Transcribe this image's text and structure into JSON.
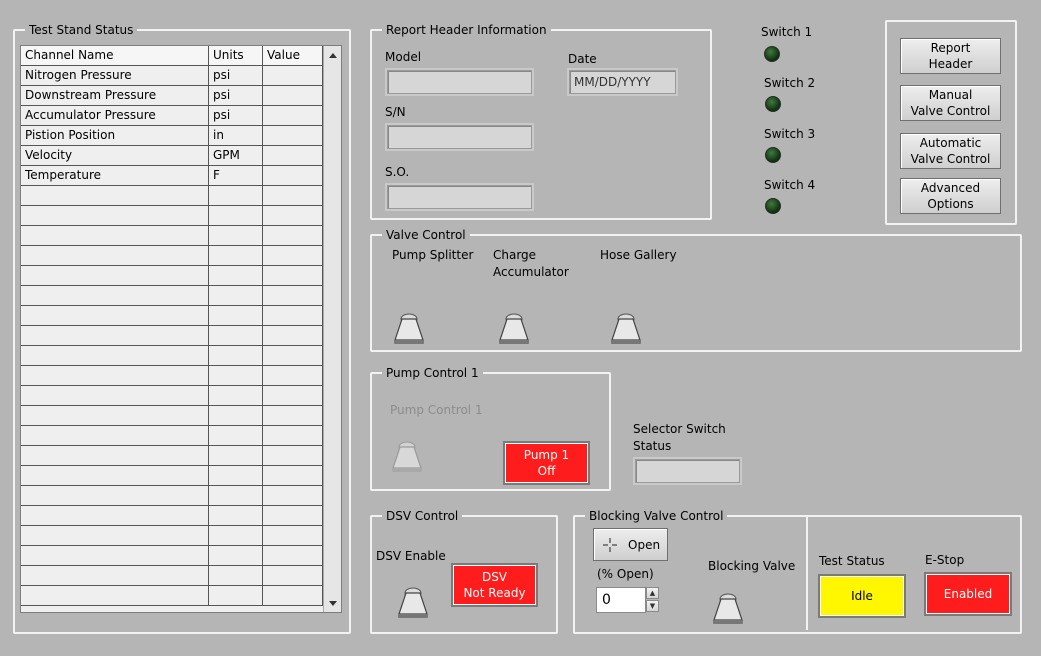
{
  "test_stand": {
    "title": "Test Stand Status",
    "columns": [
      "Channel Name",
      "Units",
      "Value"
    ],
    "rows": [
      {
        "name": "Nitrogen Pressure",
        "units": "psi",
        "value": ""
      },
      {
        "name": "Downstream Pressure",
        "units": "psi",
        "value": ""
      },
      {
        "name": "Accumulator Pressure",
        "units": "psi",
        "value": ""
      },
      {
        "name": "Pistion Position",
        "units": "in",
        "value": ""
      },
      {
        "name": "Velocity",
        "units": "GPM",
        "value": ""
      },
      {
        "name": "Temperature",
        "units": "F",
        "value": ""
      }
    ]
  },
  "report_header": {
    "title": "Report Header Information",
    "model_label": "Model",
    "model_value": "",
    "sn_label": "S/N",
    "sn_value": "",
    "so_label": "S.O.",
    "so_value": "",
    "date_label": "Date",
    "date_value": "MM/DD/YYYY"
  },
  "switches": [
    "Switch 1",
    "Switch 2",
    "Switch 3",
    "Switch 4"
  ],
  "nav_buttons": {
    "report_header": "Report\nHeader",
    "manual_valve": "Manual\nValve Control",
    "automatic_valve": "Automatic\nValve Control",
    "advanced": "Advanced\nOptions"
  },
  "valve_control": {
    "title": "Valve Control",
    "pump_splitter": "Pump Splitter",
    "charge_accumulator": "Charge\nAccumulator",
    "hose_gallery": "Hose Gallery"
  },
  "pump_control": {
    "title": "Pump Control 1",
    "toggle_label": "Pump Control 1",
    "button_label": "Pump 1\nOff"
  },
  "selector_switch": {
    "label": "Selector Switch\nStatus",
    "value": ""
  },
  "dsv_control": {
    "title": "DSV Control",
    "enable_label": "DSV Enable",
    "status_label": "DSV\nNot Ready"
  },
  "blocking_valve": {
    "title": "Blocking Valve Control",
    "open_button": "Open",
    "percent_label": "(% Open)",
    "percent_value": "0",
    "valve_label": "Blocking Valve"
  },
  "status": {
    "test_status_label": "Test Status",
    "test_status_value": "Idle",
    "estop_label": "E-Stop",
    "estop_value": "Enabled"
  },
  "colors": {
    "background": "#b5b5b5",
    "alarm_red": "#ff1c1c",
    "idle_yellow": "#fff700",
    "led_off_green": "#1f4f1f"
  }
}
